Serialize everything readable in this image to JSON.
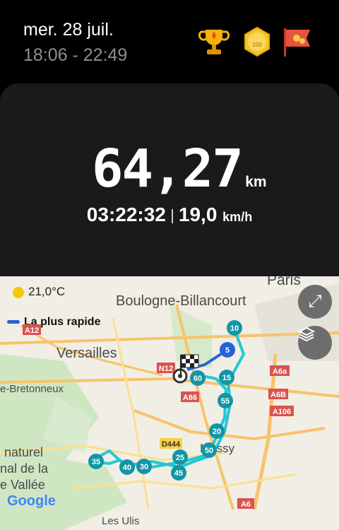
{
  "header": {
    "date": "mer. 28 juil.",
    "time_range": "18:06 - 22:49"
  },
  "summary": {
    "distance_value": "64,27",
    "distance_unit": "km",
    "duration": "03:22:32",
    "speed_value": "19,0",
    "speed_unit": "km/h"
  },
  "badges": [
    {
      "icon": "trophy-icon",
      "label": ""
    },
    {
      "icon": "medal-100-icon",
      "label": "100"
    },
    {
      "icon": "flag-icon",
      "label": ""
    }
  ],
  "map": {
    "weather": "21,0°C",
    "route_legend": "La plus rapide",
    "places": [
      "Paris",
      "Boulogne-Billancourt",
      "Versailles",
      "Massy",
      "e-Bretonneux",
      "naturel",
      "nal de la",
      "e Vallée",
      "Les Ulis"
    ],
    "roads": [
      "A12",
      "N12",
      "A86",
      "D444",
      "A6a",
      "A6B",
      "A106",
      "A6"
    ],
    "km_markers": [
      "5",
      "10",
      "15",
      "20",
      "25",
      "30",
      "35",
      "40",
      "45",
      "50",
      "55",
      "60"
    ],
    "google_text": "Google",
    "colors": {
      "route": "#22c8d6",
      "start": "#2463d6",
      "marker": "#1296a6"
    }
  }
}
